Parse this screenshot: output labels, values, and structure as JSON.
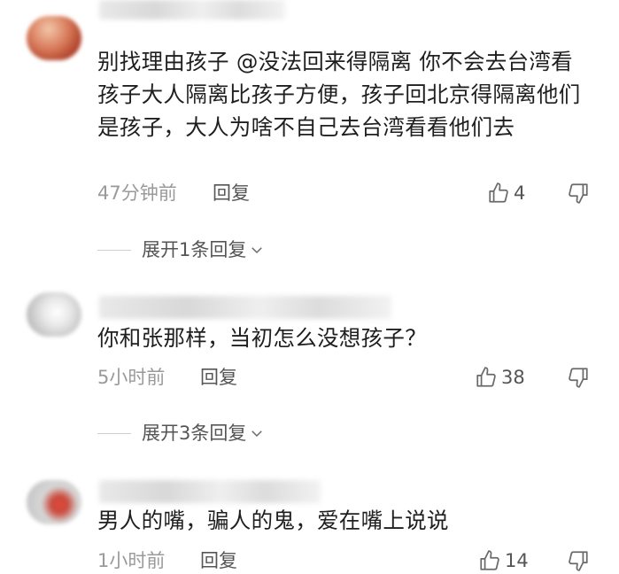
{
  "comments": [
    {
      "text": "别找理由孩子 @没法回来得隔离 你不会去台湾看孩子大人隔离比孩子方便，孩子回北京得隔离他们是孩子，大人为啥不自己去台湾看看他们去",
      "time": "47分钟前",
      "reply_label": "回复",
      "likes": "4",
      "expand_label": "展开1条回复"
    },
    {
      "text": "你和张那样，当初怎么没想孩子？",
      "time": "5小时前",
      "reply_label": "回复",
      "likes": "38",
      "expand_label": "展开3条回复"
    },
    {
      "text": "男人的嘴，骗人的鬼，爱在嘴上说说",
      "time": "1小时前",
      "reply_label": "回复",
      "likes": "14"
    }
  ],
  "colors": {
    "text": "#1f1f1f",
    "meta": "#9a9a9a",
    "action": "#555555"
  },
  "icons": [
    "thumbs-up-icon",
    "thumbs-down-icon",
    "chevron-down-icon"
  ]
}
